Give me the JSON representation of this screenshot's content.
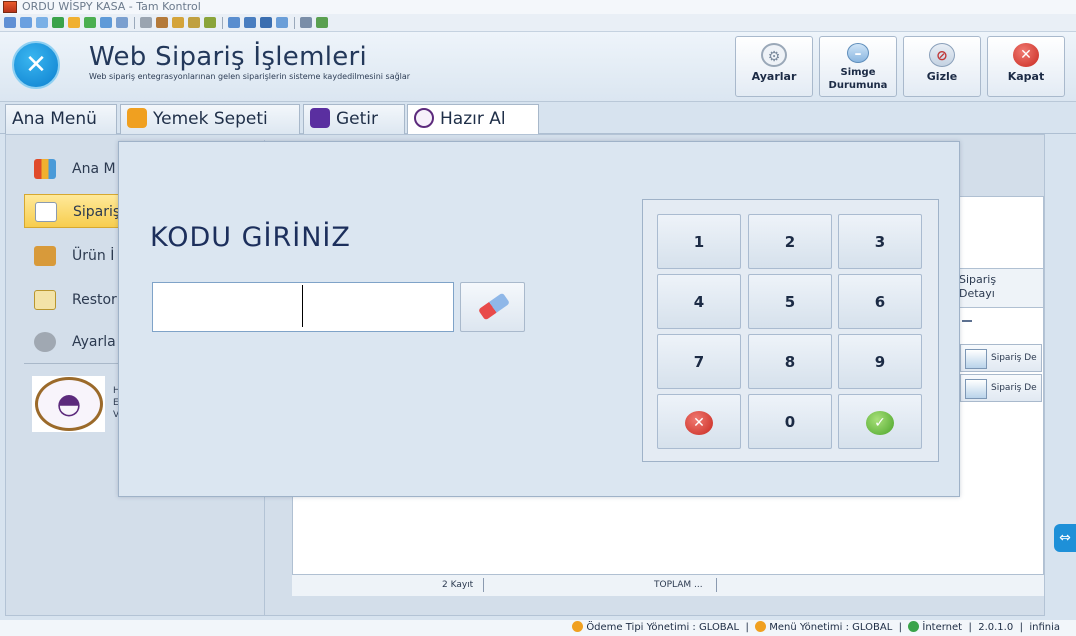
{
  "window": {
    "title": "ORDU WİSPY KASA - Tam Kontrol"
  },
  "header": {
    "title": "Web Sipariş İşlemleri",
    "subtitle": "Web sipariş entegrasyonlarınan gelen siparişlerin sisteme kaydedilmesini sağlar",
    "buttons": [
      {
        "label": "Ayarlar",
        "icon": "gear-icon"
      },
      {
        "label": "Simge Durumuna",
        "icon": "minimize-icon"
      },
      {
        "label": "Gizle",
        "icon": "hide-eye-icon"
      },
      {
        "label": "Kapat",
        "icon": "close-icon"
      }
    ]
  },
  "tabs": [
    {
      "label": "Ana Menü"
    },
    {
      "label": "Yemek Sepeti"
    },
    {
      "label": "Getir"
    },
    {
      "label": "Hazır Al"
    }
  ],
  "sidebar": {
    "items": [
      {
        "label": "Ana M"
      },
      {
        "label": "Sipariş"
      },
      {
        "label": "Ürün İ"
      },
      {
        "label": "Restor"
      },
      {
        "label": "Ayarla"
      }
    ],
    "logo_lines": [
      "H",
      "E",
      "V"
    ]
  },
  "grid": {
    "column_header": "Sipariş Detayı",
    "row_buttons": [
      "Sipariş De",
      "Sipariş De"
    ],
    "footer_count": "2 Kayıt",
    "footer_total": "TOPLAM ..."
  },
  "modal": {
    "title": "KODU GİRİNİZ",
    "input_value": "",
    "keys": [
      "1",
      "2",
      "3",
      "4",
      "5",
      "6",
      "7",
      "8",
      "9",
      "✕",
      "0",
      "✓"
    ]
  },
  "statusbar": {
    "payment": "Ödeme Tipi Yönetimi : GLOBAL",
    "menu": "Menü Yönetimi : GLOBAL",
    "internet": "İnternet",
    "version": "2.0.1.0",
    "brand": "infinia"
  },
  "colors": {
    "accent": "#1e90d8",
    "selected": "#f7cd4e",
    "close": "#d8332c",
    "ok": "#5cb82e"
  }
}
